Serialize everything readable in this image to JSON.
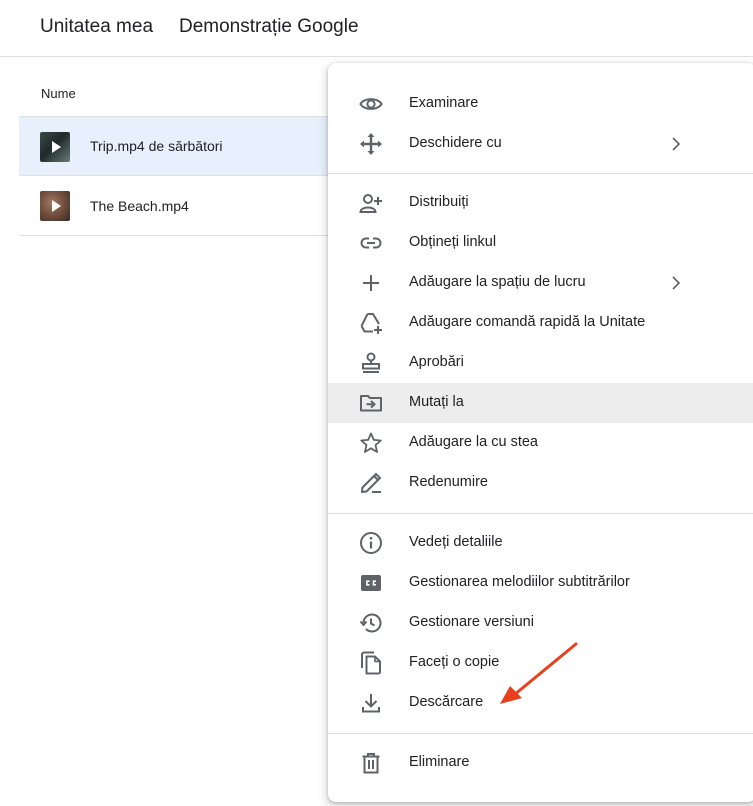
{
  "breadcrumb": {
    "root": "Unitatea mea",
    "current": "Demonstrație Google"
  },
  "file_list": {
    "column_name": "Nume",
    "rows": [
      {
        "name": "Trip.mp4 de sărbători",
        "thumb_icon": "video-thumbnail-icon",
        "selected": true
      },
      {
        "name": "The Beach.mp4",
        "thumb_icon": "video-thumbnail-icon",
        "selected": false
      }
    ]
  },
  "context_menu": {
    "items": [
      {
        "label": "Examinare",
        "icon": "eye-icon"
      },
      {
        "label": "Deschidere cu",
        "icon": "move-arrows-icon",
        "submenu": true
      },
      {
        "label": "Distribuiți",
        "icon": "person-add-icon"
      },
      {
        "label": "Obțineți linkul",
        "icon": "link-icon"
      },
      {
        "label": "Adăugare la spațiu de lucru",
        "icon": "plus-icon",
        "submenu": true
      },
      {
        "label": "Adăugare comandă rapidă la Unitate",
        "icon": "drive-shortcut-icon"
      },
      {
        "label": "Aprobări",
        "icon": "stamp-icon"
      },
      {
        "label": "Mutați la",
        "icon": "folder-move-icon",
        "highlighted": true
      },
      {
        "label": "Adăugare la cu stea",
        "icon": "star-icon"
      },
      {
        "label": "Redenumire",
        "icon": "pencil-icon"
      },
      {
        "label": "Vedeți detaliile",
        "icon": "info-icon"
      },
      {
        "label": "Gestionarea melodiilor subtitrărilor",
        "icon": "closed-captions-icon"
      },
      {
        "label": "Gestionare versiuni",
        "icon": "history-icon"
      },
      {
        "label": "Faceți o copie",
        "icon": "copy-icon"
      },
      {
        "label": "Descărcare",
        "icon": "download-icon"
      },
      {
        "label": "Eliminare",
        "icon": "trash-icon"
      }
    ]
  },
  "annotation": {
    "color": "#e8401c",
    "points_to": "Descărcare"
  },
  "colors": {
    "selected_row": "#e8f0fe",
    "highlighted_item": "#ededed",
    "icon": "#5f6368"
  }
}
